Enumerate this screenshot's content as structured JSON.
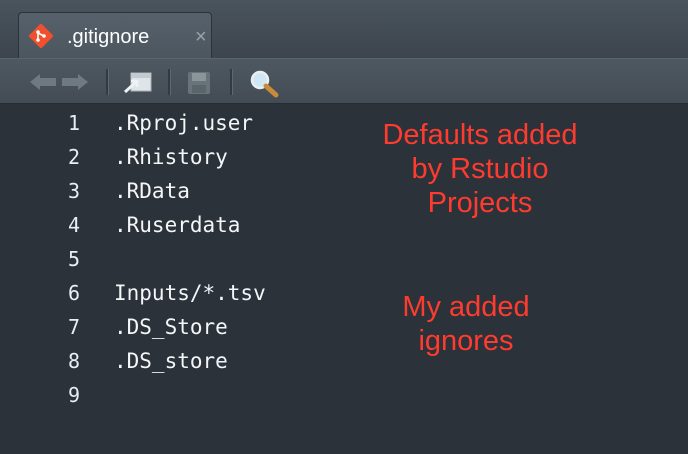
{
  "tab": {
    "title": ".gitignore",
    "close_glyph": "×",
    "icon": "git-icon"
  },
  "toolbar": {
    "buttons": [
      {
        "name": "back-icon"
      },
      {
        "name": "forward-icon"
      },
      {
        "name": "show-in-window-icon"
      },
      {
        "name": "save-icon"
      },
      {
        "name": "find-replace-icon"
      }
    ]
  },
  "editor": {
    "lines": [
      {
        "number": "1",
        "text": ".Rproj.user"
      },
      {
        "number": "2",
        "text": ".Rhistory"
      },
      {
        "number": "3",
        "text": ".RData"
      },
      {
        "number": "4",
        "text": ".Ruserdata"
      },
      {
        "number": "5",
        "text": ""
      },
      {
        "number": "6",
        "text": "Inputs/*.tsv"
      },
      {
        "number": "7",
        "text": ".DS_Store"
      },
      {
        "number": "8",
        "text": ".DS_store"
      },
      {
        "number": "9",
        "text": ""
      }
    ]
  },
  "annotations": {
    "defaults": [
      "Defaults added",
      "by Rstudio",
      "Projects"
    ],
    "mine": [
      "My added",
      "ignores"
    ]
  },
  "colors": {
    "annotation": "#ff3b2f",
    "background": "#2b3239"
  }
}
